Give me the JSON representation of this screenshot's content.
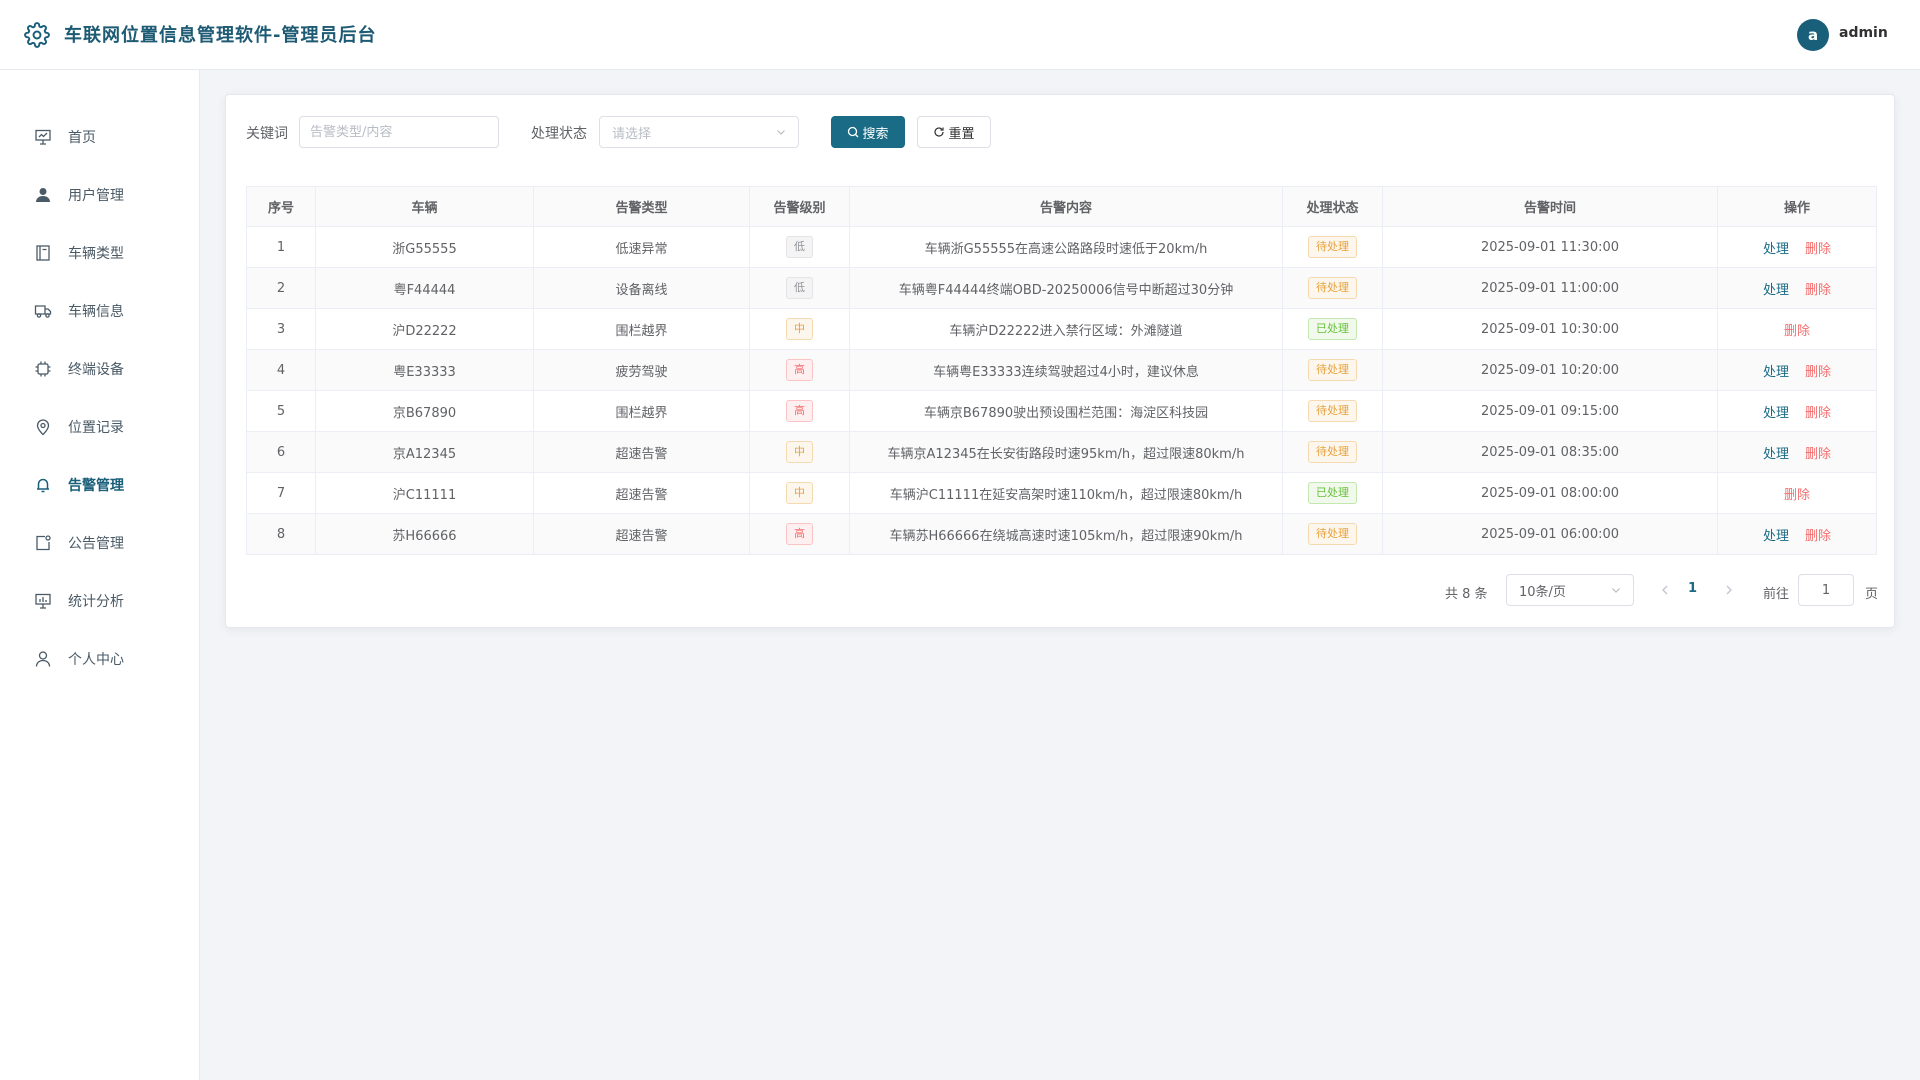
{
  "header": {
    "title": "车联网位置信息管理软件-管理员后台",
    "avatar_letter": "a",
    "username": "admin",
    "accent": "#1a5f7a"
  },
  "sidebar": {
    "items": [
      {
        "label": "首页",
        "icon": "presentation-icon",
        "active": false
      },
      {
        "label": "用户管理",
        "icon": "user-icon",
        "active": false
      },
      {
        "label": "车辆类型",
        "icon": "notebook-icon",
        "active": false
      },
      {
        "label": "车辆信息",
        "icon": "truck-icon",
        "active": false
      },
      {
        "label": "终端设备",
        "icon": "cpu-icon",
        "active": false
      },
      {
        "label": "位置记录",
        "icon": "location-icon",
        "active": false
      },
      {
        "label": "告警管理",
        "icon": "bell-icon",
        "active": true
      },
      {
        "label": "公告管理",
        "icon": "notice-icon",
        "active": false
      },
      {
        "label": "统计分析",
        "icon": "chart-board-icon",
        "active": false
      },
      {
        "label": "个人中心",
        "icon": "person-icon",
        "active": false
      }
    ]
  },
  "filters": {
    "keyword_label": "关键词",
    "keyword_placeholder": "告警类型/内容",
    "status_label": "处理状态",
    "status_placeholder": "请选择",
    "search_label": "搜索",
    "reset_label": "重置"
  },
  "table": {
    "columns": [
      "序号",
      "车辆",
      "告警类型",
      "告警级别",
      "告警内容",
      "处理状态",
      "告警时间",
      "操作"
    ],
    "rows": [
      {
        "no": "1",
        "vehicle": "浙G55555",
        "type": "低速异常",
        "level": "低",
        "level_class": "lv-low",
        "content": "车辆浙G55555在高速公路路段时速低于20km/h",
        "status": "待处理",
        "status_class": "st-pending",
        "time": "2025-09-01 11:30:00",
        "handle": true
      },
      {
        "no": "2",
        "vehicle": "粤F44444",
        "type": "设备离线",
        "level": "低",
        "level_class": "lv-low",
        "content": "车辆粤F44444终端OBD-20250006信号中断超过30分钟",
        "status": "待处理",
        "status_class": "st-pending",
        "time": "2025-09-01 11:00:00",
        "handle": true
      },
      {
        "no": "3",
        "vehicle": "沪D22222",
        "type": "围栏越界",
        "level": "中",
        "level_class": "lv-mid",
        "content": "车辆沪D22222进入禁行区域：外滩隧道",
        "status": "已处理",
        "status_class": "st-done",
        "time": "2025-09-01 10:30:00",
        "handle": false
      },
      {
        "no": "4",
        "vehicle": "粤E33333",
        "type": "疲劳驾驶",
        "level": "高",
        "level_class": "lv-high",
        "content": "车辆粤E33333连续驾驶超过4小时，建议休息",
        "status": "待处理",
        "status_class": "st-pending",
        "time": "2025-09-01 10:20:00",
        "handle": true
      },
      {
        "no": "5",
        "vehicle": "京B67890",
        "type": "围栏越界",
        "level": "高",
        "level_class": "lv-high",
        "content": "车辆京B67890驶出预设围栏范围：海淀区科技园",
        "status": "待处理",
        "status_class": "st-pending",
        "time": "2025-09-01 09:15:00",
        "handle": true
      },
      {
        "no": "6",
        "vehicle": "京A12345",
        "type": "超速告警",
        "level": "中",
        "level_class": "lv-mid",
        "content": "车辆京A12345在长安街路段时速95km/h，超过限速80km/h",
        "status": "待处理",
        "status_class": "st-pending",
        "time": "2025-09-01 08:35:00",
        "handle": true
      },
      {
        "no": "7",
        "vehicle": "沪C11111",
        "type": "超速告警",
        "level": "中",
        "level_class": "lv-mid",
        "content": "车辆沪C11111在延安高架时速110km/h，超过限速80km/h",
        "status": "已处理",
        "status_class": "st-done",
        "time": "2025-09-01 08:00:00",
        "handle": false
      },
      {
        "no": "8",
        "vehicle": "苏H66666",
        "type": "超速告警",
        "level": "高",
        "level_class": "lv-high",
        "content": "车辆苏H66666在绕城高速时速105km/h，超过限速90km/h",
        "status": "待处理",
        "status_class": "st-pending",
        "time": "2025-09-01 06:00:00",
        "handle": true
      }
    ],
    "action_handle": "处理",
    "action_delete": "删除"
  },
  "pagination": {
    "total": "共 8 条",
    "page_size": "10条/页",
    "current": "1",
    "goto_label": "前往",
    "goto_value": "1",
    "page_suffix": "页"
  }
}
